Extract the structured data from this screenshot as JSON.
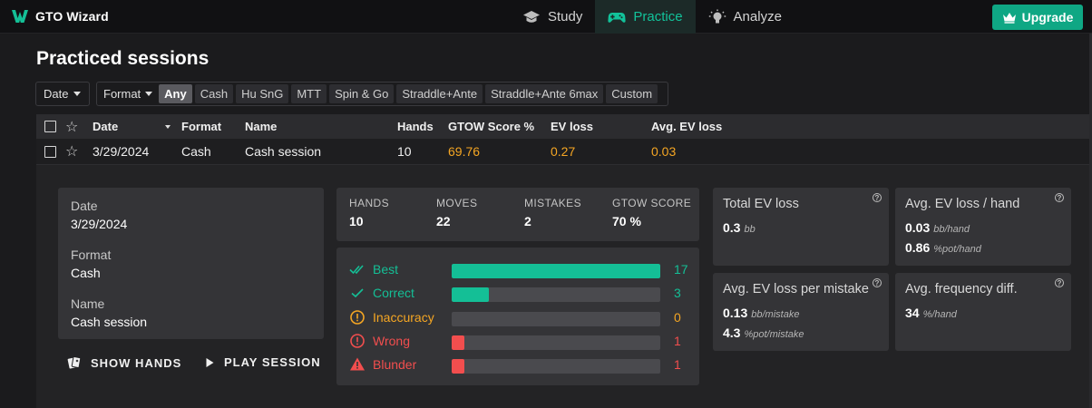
{
  "header": {
    "brand": "GTO Wizard",
    "nav": [
      {
        "label": "Study",
        "icon": "graduation-cap-icon"
      },
      {
        "label": "Practice",
        "icon": "gamepad-icon",
        "active": true
      },
      {
        "label": "Analyze",
        "icon": "lightbulb-icon"
      }
    ],
    "upgrade_label": "Upgrade"
  },
  "page": {
    "title": "Practiced sessions"
  },
  "filters": {
    "date_label": "Date",
    "format_label": "Format",
    "format_options": [
      "Any",
      "Cash",
      "Hu SnG",
      "MTT",
      "Spin & Go",
      "Straddle+Ante",
      "Straddle+Ante 6max",
      "Custom"
    ],
    "format_selected": "Any"
  },
  "table": {
    "columns": [
      "Date",
      "Format",
      "Name",
      "Hands",
      "GTOW Score %",
      "EV loss",
      "Avg. EV loss"
    ],
    "rows": [
      {
        "date": "3/29/2024",
        "format": "Cash",
        "name": "Cash session",
        "hands": "10",
        "score": "69.76",
        "ev_loss": "0.27",
        "avg_ev_loss": "0.03"
      }
    ]
  },
  "detail": {
    "info": [
      {
        "label": "Date",
        "value": "3/29/2024"
      },
      {
        "label": "Format",
        "value": "Cash"
      },
      {
        "label": "Name",
        "value": "Cash session"
      }
    ],
    "actions": {
      "show_hands": "SHOW HANDS",
      "play_session": "PLAY SESSION"
    },
    "stats": [
      {
        "label": "HANDS",
        "value": "10"
      },
      {
        "label": "MOVES",
        "value": "22"
      },
      {
        "label": "MISTAKES",
        "value": "2"
      },
      {
        "label": "GTOW SCORE",
        "value": "70 %"
      }
    ],
    "breakdown": [
      {
        "label": "Best",
        "count": "17",
        "fraction": 1.0,
        "color": "#14bf96",
        "icon": "double-check-icon"
      },
      {
        "label": "Correct",
        "count": "3",
        "fraction": 0.18,
        "color": "#14bf96",
        "icon": "check-icon"
      },
      {
        "label": "Inaccuracy",
        "count": "0",
        "fraction": 0.0,
        "color": "#f5a623",
        "icon": "info-circle-icon"
      },
      {
        "label": "Wrong",
        "count": "1",
        "fraction": 0.06,
        "color": "#f24e4e",
        "icon": "alert-circle-icon"
      },
      {
        "label": "Blunder",
        "count": "1",
        "fraction": 0.06,
        "color": "#f24e4e",
        "icon": "warning-triangle-icon"
      }
    ],
    "metrics": {
      "total_ev_loss": {
        "title": "Total EV loss",
        "value": "0.3",
        "unit": "bb"
      },
      "avg_ev_loss_hand": {
        "title": "Avg. EV loss / hand",
        "v1": "0.03",
        "u1": "bb/hand",
        "v2": "0.86",
        "u2": "%pot/hand"
      },
      "avg_ev_loss_mistake": {
        "title": "Avg. EV loss per mistake",
        "v1": "0.13",
        "u1": "bb/mistake",
        "v2": "4.3",
        "u2": "%pot/mistake"
      },
      "avg_freq_diff": {
        "title": "Avg. frequency diff.",
        "value": "34",
        "unit": "%/hand"
      }
    }
  },
  "colors": {
    "accent": "#0fa784",
    "good": "#14bf96",
    "warn": "#f5a623",
    "bad": "#f24e4e"
  }
}
